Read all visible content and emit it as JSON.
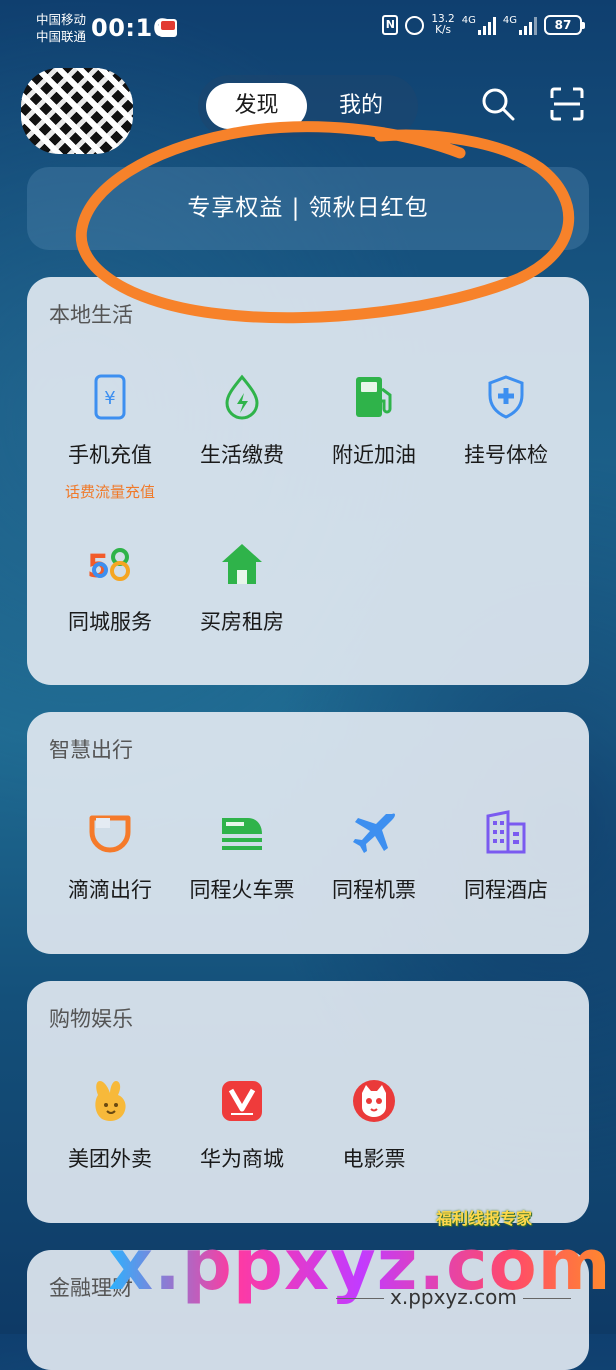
{
  "status_bar": {
    "carrier_1": "中国移动",
    "carrier_2": "中国联通",
    "time": "00:16",
    "nfc": "N",
    "net_speed_value": "13.2",
    "net_speed_unit": "K/s",
    "network_1": "4G",
    "network_2": "4G",
    "battery": "87"
  },
  "header": {
    "tabs": [
      {
        "label": "发现",
        "active": true
      },
      {
        "label": "我的",
        "active": false
      }
    ]
  },
  "banner": {
    "text": "专享权益 | 领秋日红包"
  },
  "sections": [
    {
      "title": "本地生活",
      "items": [
        {
          "label": "手机充值",
          "sublabel": "话费流量充值",
          "icon": "phone-recharge-icon"
        },
        {
          "label": "生活缴费",
          "icon": "utility-bill-icon"
        },
        {
          "label": "附近加油",
          "icon": "gas-station-icon"
        },
        {
          "label": "挂号体检",
          "icon": "medical-shield-icon"
        },
        {
          "label": "同城服务",
          "icon": "58-logo-icon"
        },
        {
          "label": "买房租房",
          "icon": "house-icon"
        }
      ]
    },
    {
      "title": "智慧出行",
      "items": [
        {
          "label": "滴滴出行",
          "icon": "didi-logo-icon"
        },
        {
          "label": "同程火车票",
          "icon": "train-icon"
        },
        {
          "label": "同程机票",
          "icon": "airplane-icon"
        },
        {
          "label": "同程酒店",
          "icon": "hotel-building-icon"
        }
      ]
    },
    {
      "title": "购物娱乐",
      "items": [
        {
          "label": "美团外卖",
          "icon": "meituan-rabbit-icon"
        },
        {
          "label": "华为商城",
          "icon": "vmall-icon"
        },
        {
          "label": "电影票",
          "icon": "movie-cat-icon"
        }
      ]
    },
    {
      "title": "金融理财",
      "items": []
    }
  ],
  "watermark": {
    "logo_text": "福利线报专家",
    "site_big": "x.ppxyz.com",
    "site_small": "x.ppxyz.com"
  },
  "colors": {
    "accent_orange": "#f07a2a",
    "annotation_circle": "#f7822a",
    "icon_blue": "#3d8ff0",
    "icon_green": "#2fb34a"
  }
}
